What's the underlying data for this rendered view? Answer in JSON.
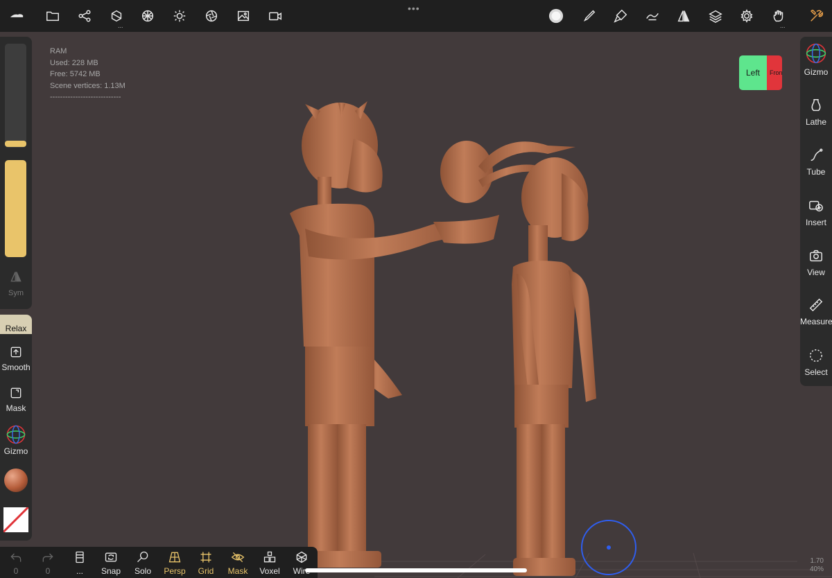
{
  "stats": {
    "ram": "RAM",
    "used": "Used: 228 MB",
    "free": "Free: 5742 MB",
    "vertices": "Scene vertices: 1.13M",
    "separator": "----------------------------"
  },
  "topbar": {
    "dots": "•••",
    "sub_marker": "..."
  },
  "left_panel": {
    "sym_label": "Sym",
    "relax_label": "Relax",
    "smooth_label": "Smooth",
    "mask_label": "Mask",
    "gizmo_label": "Gizmo"
  },
  "right_panel": {
    "gizmo_label": "Gizmo",
    "lathe_label": "Lathe",
    "tube_label": "Tube",
    "insert_label": "Insert",
    "view_label": "View",
    "measure_label": "Measure",
    "select_label": "Select"
  },
  "view_cube": {
    "left_label": "Left",
    "front_label": "Front"
  },
  "bottom_bar": {
    "undo_count": "0",
    "redo_count": "0",
    "layers_label": "...",
    "snap_label": "Snap",
    "solo_label": "Solo",
    "persp_label": "Persp",
    "grid_label": "Grid",
    "mask_label": "Mask",
    "voxel_label": "Voxel",
    "wire_label": "Wire"
  },
  "zoom": {
    "scale": "1.70",
    "percent": "40%"
  },
  "colors": {
    "background": "#423a3b",
    "panel": "#2b2b2b",
    "accent": "#e9c46a",
    "clay": "#b6734f",
    "pivot": "#2f5ef0"
  }
}
